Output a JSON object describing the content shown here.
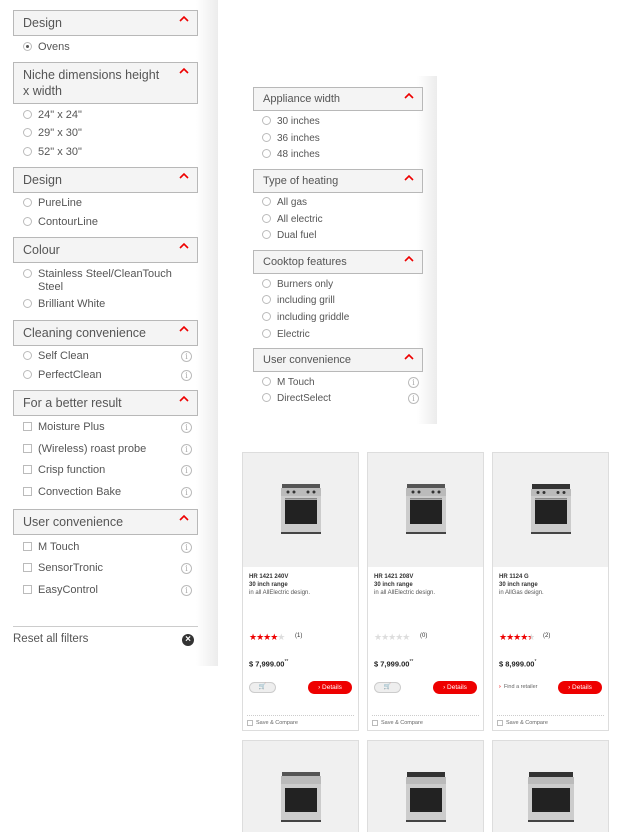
{
  "left_filters": {
    "design_1": {
      "title": "Design",
      "options": [
        "Ovens"
      ]
    },
    "niche": {
      "title": "Niche dimensions height x width",
      "options": [
        "24\" x 24\"",
        "29\" x 30\"",
        "52\" x 30\""
      ]
    },
    "design_2": {
      "title": "Design",
      "options": [
        "PureLine",
        "ContourLine"
      ]
    },
    "colour": {
      "title": "Colour",
      "options": [
        "Stainless Steel/CleanTouch Steel",
        "Brilliant White"
      ]
    },
    "cleaning": {
      "title": "Cleaning convenience",
      "options": [
        "Self Clean",
        "PerfectClean"
      ]
    },
    "better_result": {
      "title": "For a better result",
      "options": [
        "Moisture Plus",
        "(Wireless) roast probe",
        "Crisp function",
        "Convection Bake"
      ]
    },
    "user_conv": {
      "title": "User convenience",
      "options": [
        "M Touch",
        "SensorTronic",
        "EasyControl"
      ]
    },
    "reset_label": "Reset all filters",
    "reset_icon": "close-circle-icon"
  },
  "mid_filters": {
    "width": {
      "title": "Appliance width",
      "options": [
        "30 inches",
        "36 inches",
        "48 inches"
      ]
    },
    "heating": {
      "title": "Type of heating",
      "options": [
        "All gas",
        "All electric",
        "Dual fuel"
      ]
    },
    "cooktop": {
      "title": "Cooktop features",
      "options": [
        "Burners only",
        "including grill",
        "including griddle",
        "Electric"
      ]
    },
    "user_conv": {
      "title": "User convenience",
      "options": [
        "M Touch",
        "DirectSelect"
      ]
    }
  },
  "products": [
    {
      "model": "HR 1421 240V",
      "size": "30 inch range",
      "desc": "in all AllElectric design.",
      "rating": 4,
      "rating_count": "(1)",
      "price": "$ 7,999.00",
      "price_suffix": "**",
      "action": "cart",
      "details": "Details",
      "save": "Save & Compare"
    },
    {
      "model": "HR 1421 208V",
      "size": "30 inch range",
      "desc": "in all AllElectric design.",
      "rating": 0,
      "rating_count": "(0)",
      "price": "$ 7,999.00",
      "price_suffix": "**",
      "action": "cart",
      "details": "Details",
      "save": "Save & Compare"
    },
    {
      "model": "HR 1124 G",
      "size": "30 inch range",
      "desc": "in AllGas design.",
      "rating": 4.5,
      "rating_count": "(2)",
      "price": "$ 8,999.00",
      "price_suffix": "*",
      "action": "retailer",
      "retailer_label": "Find a retailer",
      "details": "Details",
      "save": "Save & Compare"
    }
  ],
  "colors": {
    "accent": "#e00000",
    "border": "#b8b8b8",
    "panel": "#f4f4f4"
  }
}
